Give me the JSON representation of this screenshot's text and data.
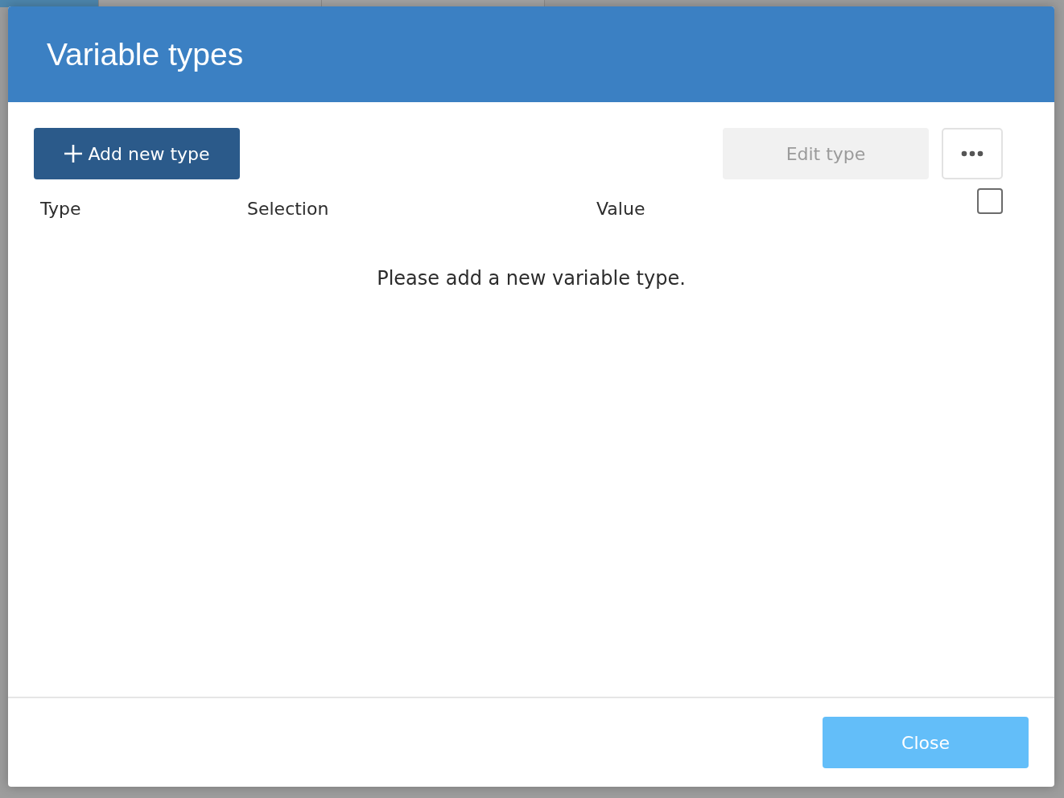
{
  "dialog": {
    "title": "Variable types",
    "toolbar": {
      "add_button": "Add new type",
      "edit_button": {
        "label": "Edit type",
        "disabled": true
      }
    },
    "table": {
      "columns": [
        "Type",
        "Selection",
        "Value"
      ],
      "select_all": {
        "checked": false
      },
      "empty_message": "Please add a new variable type."
    },
    "footer": {
      "close_button": "Close"
    }
  }
}
